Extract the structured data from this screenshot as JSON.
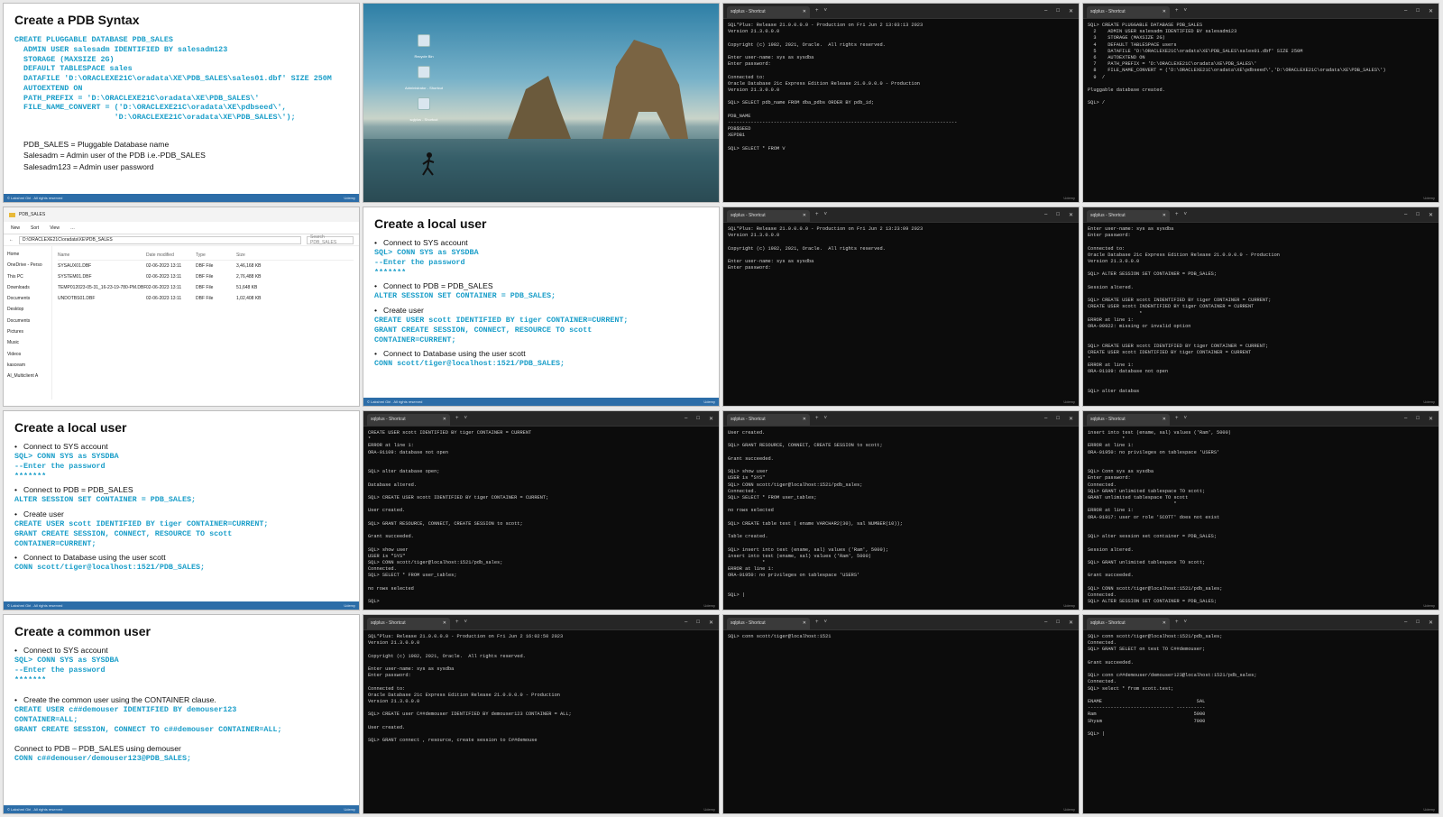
{
  "term_common": {
    "tab_title": "sqlplus - Shortcut",
    "new_tab": "+",
    "dropdown": "˅",
    "minimize": "–",
    "maximize": "□",
    "close": "✕",
    "watermark": "Udemy"
  },
  "slide_common": {
    "footer_left": "© Lakshmi Giri . All rights reserved",
    "footer_right": "Udemy"
  },
  "cell1": {
    "title": "Create a PDB Syntax",
    "code": "CREATE PLUGGABLE DATABASE PDB_SALES\n  ADMIN USER salesadm IDENTIFIED BY salesadm123\n  STORAGE (MAXSIZE 2G)\n  DEFAULT TABLESPACE sales\n  DATAFILE 'D:\\ORACLEXE21C\\oradata\\XE\\PDB_SALES\\sales01.dbf' SIZE 250M\n  AUTOEXTEND ON\n  PATH_PREFIX = 'D:\\ORACLEXE21C\\oradata\\XE\\PDB_SALES\\'\n  FILE_NAME_CONVERT = ('D:\\ORACLEXE21C\\oradata\\XE\\pdbseed\\',\n                      'D:\\ORACLEXE21C\\oradata\\XE\\PDB_SALES\\');",
    "notes": [
      "PDB_SALES = Pluggable Database name",
      "Salesadm = Admin user of the PDB i.e.-PDB_SALES",
      "Salesadm123 = Admin user password"
    ]
  },
  "cell2": {
    "icons": [
      "Recycle Bin",
      "Administrator - Shortcut",
      "sqlplus - Shortcut"
    ]
  },
  "cell3": {
    "text": "SQL*Plus: Release 21.0.0.0.0 - Production on Fri Jun 2 13:03:13 2023\nVersion 21.3.0.0.0\n\nCopyright (c) 1982, 2021, Oracle.  All rights reserved.\n\nEnter user-name: sys as sysdba\nEnter password:\n\nConnected to:\nOracle Database 21c Express Edition Release 21.0.0.0.0 - Production\nVersion 21.3.0.0.0\n\nSQL> SELECT pdb_name FROM dba_pdbs ORDER BY pdb_id;\n\nPDB_NAME\n--------------------------------------------------------------------------------\nPDB$SEED\nXEPDB1\n\nSQL> SELECT * FROM V"
  },
  "cell4": {
    "text": "SQL> CREATE PLUGGABLE DATABASE PDB_SALES\n  2    ADMIN USER salesadm IDENTIFIED BY salesadm123\n  3    STORAGE (MAXSIZE 2G)\n  4    DEFAULT TABLESPACE users\n  5    DATAFILE 'D:\\ORACLEXE21C\\oradata\\XE\\PDB_SALES\\sales01.dbf' SIZE 250M\n  6    AUTOEXTEND ON\n  7    PATH_PREFIX = 'D:\\ORACLEXE21C\\oradata\\XE\\PDB_SALES\\'\n  8    FILE_NAME_CONVERT = ('D:\\ORACLEXE21C\\oradata\\XE\\pdbseed\\','D:\\ORACLEXE21C\\oradata\\XE\\PDB_SALES\\')\n  9  /\n\nPluggable database created.\n\nSQL> /"
  },
  "cell5": {
    "window_title": "PDB_SALES",
    "toolbar": [
      "New",
      "Sort",
      "View",
      "…"
    ],
    "address": "D:\\ORACLEXE21C\\oradata\\XE\\PDB_SALES",
    "search_placeholder": "Search PDB_SALES",
    "nav": [
      "Home",
      "OneDrive - Perso",
      "This PC",
      "Downloads",
      "Documents",
      "Desktop",
      "Documents",
      "Pictures",
      "Music",
      "Videos",
      "kasceam",
      "AI_Multiclient A"
    ],
    "headers": [
      "Name",
      "Date modified",
      "Type",
      "Size"
    ],
    "files": [
      [
        "SYSAUX01.DBF",
        "02-06-2023 13:11",
        "DBF File",
        "3,46,168 KB"
      ],
      [
        "SYSTEM01.DBF",
        "02-06-2023 13:11",
        "DBF File",
        "2,76,488 KB"
      ],
      [
        "TEMP012023-05-31_16-23-19-780-PM.DBF",
        "02-06-2023 13:11",
        "DBF File",
        "51,648 KB"
      ],
      [
        "UNDOTBS01.DBF",
        "02-06-2023 13:11",
        "DBF File",
        "1,02,408 KB"
      ]
    ]
  },
  "cell6": {
    "title": "Create a local user",
    "items": [
      {
        "label": "Connect to SYS account",
        "code": "SQL> CONN SYS as SYSDBA\n--Enter the password\n*******"
      },
      {
        "label": "Connect to PDB = PDB_SALES",
        "code": "ALTER SESSION SET CONTAINER = PDB_SALES;"
      },
      {
        "label": "Create user",
        "code": "CREATE USER scott IDENTIFIED BY tiger CONTAINER=CURRENT;\nGRANT CREATE SESSION, CONNECT, RESOURCE TO scott\nCONTAINER=CURRENT;"
      },
      {
        "label": "Connect to Database using the user scott",
        "code": "CONN scott/tiger@localhost:1521/PDB_SALES;"
      }
    ]
  },
  "cell7": {
    "text": "SQL*Plus: Release 21.0.0.0.0 - Production on Fri Jun 2 13:23:09 2023\nVersion 21.3.0.0.0\n\nCopyright (c) 1982, 2021, Oracle.  All rights reserved.\n\nEnter user-name: sys as sysdba\nEnter password:"
  },
  "cell8": {
    "text": "Enter user-name: sys as sysdba\nEnter password:\n\nConnected to:\nOracle Database 21c Express Edition Release 21.0.0.0.0 - Production\nVersion 21.3.0.0.0\n\nSQL> ALTER SESSION SET CONTAINER = PDB_SALES;\n\nSession altered.\n\nSQL> CREATE USER scott INDENTIFIED BY tiger CONTAINER = CURRENT;\nCREATE USER scott INDENTIFIED BY tiger CONTAINER = CURRENT\n                  *\nERROR at line 1:\nORA-00922: missing or invalid option\n\n\nSQL> CREATE USER scott IDENTIFIED BY tiger CONTAINER = CURRENT;\nCREATE USER scott IDENTIFIED BY tiger CONTAINER = CURRENT\n*\nERROR at line 1:\nORA-01109: database not open\n\n\nSQL> alter databas"
  },
  "cell9": {
    "title": "Create a local user",
    "items": [
      {
        "label": "Connect to SYS account",
        "code": "SQL> CONN SYS as SYSDBA\n--Enter the password\n*******"
      },
      {
        "label": "Connect to PDB = PDB_SALES",
        "code": "ALTER SESSION SET CONTAINER = PDB_SALES;"
      },
      {
        "label": "Create user",
        "code": "CREATE USER scott IDENTIFIED BY tiger CONTAINER=CURRENT;\nGRANT CREATE SESSION, CONNECT, RESOURCE TO scott\nCONTAINER=CURRENT;"
      },
      {
        "label": "Connect to Database using the user scott",
        "code": "CONN scott/tiger@localhost:1521/PDB_SALES;"
      }
    ]
  },
  "cell10": {
    "text": "CREATE USER scott IDENTIFIED BY tiger CONTAINER = CURRENT\n*\nERROR at line 1:\nORA-01109: database not open\n\n\nSQL> alter database open;\n\nDatabase altered.\n\nSQL> CREATE USER scott IDENTIFIED BY tiger CONTAINER = CURRENT;\n\nUser created.\n\nSQL> GRANT RESOURCE, CONNECT, CREATE SESSION to scott;\n\nGrant succeeded.\n\nSQL> show user\nUSER is \"SYS\"\nSQL> CONN scott/tiger@localhost:1521/pdb_sales;\nConnected.\nSQL> SELECT * FROM user_tables;\n\nno rows selected\n\nSQL>"
  },
  "cell11": {
    "text": "User created.\n\nSQL> GRANT RESOURCE, CONNECT, CREATE SESSION to scott;\n\nGrant succeeded.\n\nSQL> show user\nUSER is \"SYS\"\nSQL> CONN scott/tiger@localhost:1521/pdb_sales;\nConnected.\nSQL> SELECT * FROM user_tables;\n\nno rows selected\n\nSQL> CREATE table test ( ename VARCHAR2(30), sal NUMBER(10));\n\nTable created.\n\nSQL> insert into test (ename, sal) values ('Ram', 5000);\ninsert into test (ename, sal) values ('Ram', 5000)\n            *\nERROR at line 1:\nORA-01950: no privileges on tablespace 'USERS'\n\n\nSQL> |"
  },
  "cell12": {
    "text": "insert into test (ename, sal) values ('Ram', 5000)\n            *\nERROR at line 1:\nORA-01950: no privileges on tablespace 'USERS'\n\n\nSQL> Conn sys as sysdba\nEnter password:\nConnected.\nSQL> GRANT unlimited tablespace TO scott;\nGRANT unlimited tablespace TO scott\n                              *\nERROR at line 1:\nORA-01917: user or role 'SCOTT' does not exist\n\n\nSQL> alter session set container = PDB_SALES;\n\nSession altered.\n\nSQL> GRANT unlimited tablespace TO scott;\n\nGrant succeeded.\n\nSQL> CONN scott/tiger@localhost:1521/pdb_sales;\nConnected.\nSQL> ALTER SESSION SET CONTAINER = PDB_SALES;"
  },
  "cell13": {
    "title": "Create a common user",
    "items": [
      {
        "label": "Connect to SYS account",
        "code": "SQL> CONN SYS as SYSDBA\n--Enter the password\n*******"
      },
      {
        "label": "Create the common user using the CONTAINER clause.",
        "code": "CREATE USER c##demouser IDENTIFIED BY demouser123\nCONTAINER=ALL;\nGRANT CREATE SESSION, CONNECT TO c##demouser CONTAINER=ALL;"
      }
    ],
    "plain": "Connect to PDB – PDB_SALES using demouser",
    "plain_code": "CONN c##demouser/demouser123@PDB_SALES;"
  },
  "cell14": {
    "text": "SQL*Plus: Release 21.0.0.0.0 - Production on Fri Jun 2 16:02:50 2023\nVersion 21.3.0.0.0\n\nCopyright (c) 1982, 2021, Oracle.  All rights reserved.\n\nEnter user-name: sys as sysdba\nEnter password:\n\nConnected to:\nOracle Database 21c Express Edition Release 21.0.0.0.0 - Production\nVersion 21.3.0.0.0\n\nSQL> CREATE user C##demouser IDENTIFIED BY demouser123 CONTAINER = ALL;\n\nUser created.\n\nSQL> GRANT connect , resource, create session to C##demouse"
  },
  "cell15": {
    "text": "SQL> conn scott/tiger@localhost:1521"
  },
  "cell16": {
    "text": "SQL> conn scott/tiger@localhost:1521/pdb_sales;\nConnected.\nSQL> GRANT SELECT on test TO C##demouser;\n\nGrant succeeded.\n\nSQL> conn c##demouser/demouser123@localhost:1521/pdb_sales;\nConnected.\nSQL> select * from scott.test;\n\nENAME                                 SAL\n------------------------------ ----------\nRam                                  5000\nShyam                                7000\n\nSQL> |"
  }
}
